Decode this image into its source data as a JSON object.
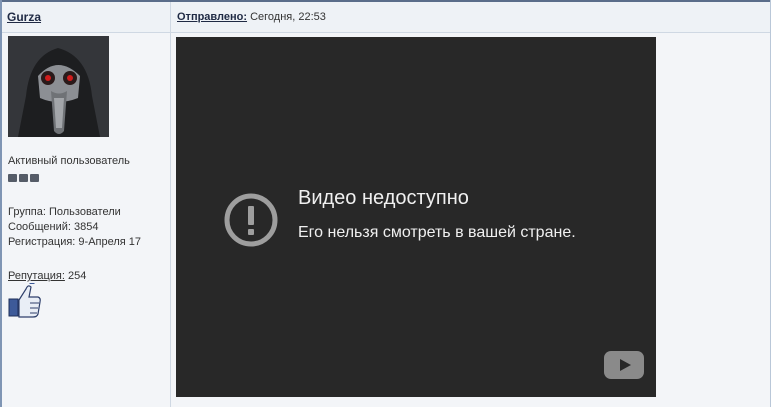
{
  "post": {
    "author": "Gurza",
    "sent_label": "Отправлено:",
    "sent_time": "Сегодня, 22:53"
  },
  "profile": {
    "title": "Активный пользователь",
    "group": "Группа: Пользователи",
    "posts": "Сообщений: 3854",
    "registered": "Регистрация: 9-Апреля 17",
    "reputation_label": "Репутация:",
    "reputation_value": "254"
  },
  "video": {
    "title": "Видео недоступно",
    "subtitle": "Его нельзя смотреть в вашей стране."
  },
  "icons": {
    "error": "error-circle-icon",
    "youtube": "youtube-logo-icon",
    "reputation": "thumbs-up-icon"
  }
}
